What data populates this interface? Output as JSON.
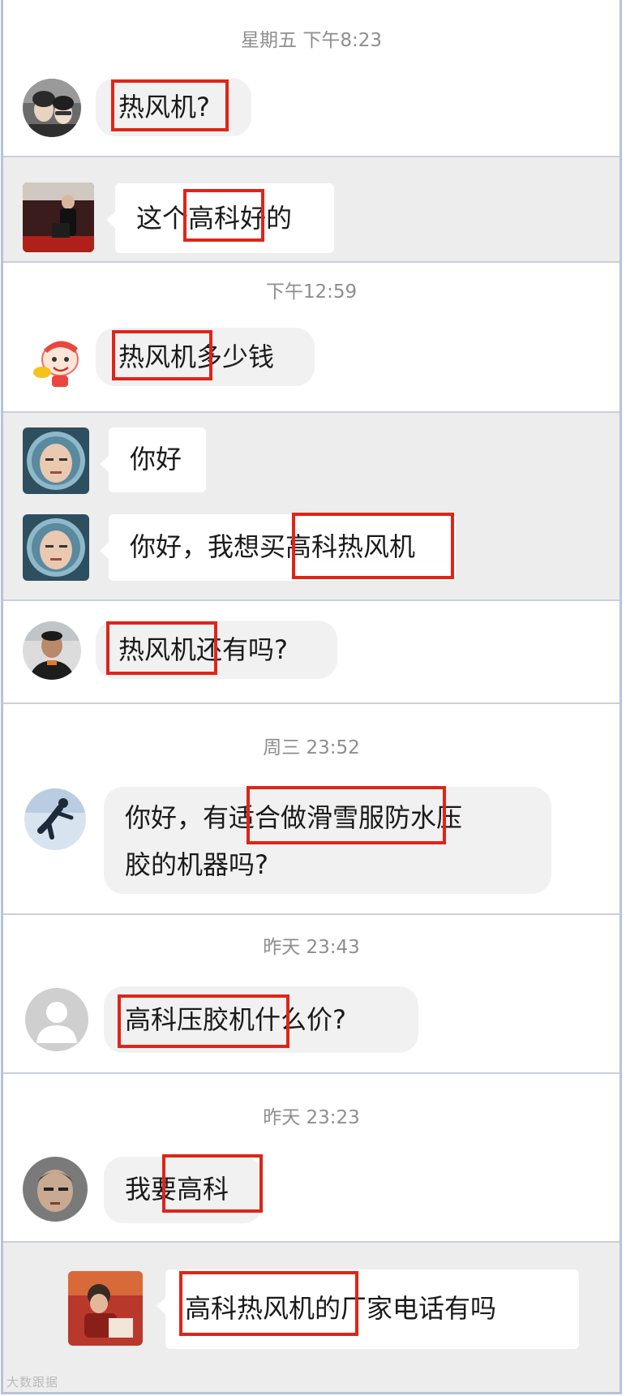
{
  "conversations": [
    {
      "id": "c1",
      "timestamp": "星期五 下午8:23",
      "messages": [
        {
          "text": "热风机?",
          "avatar": "couple-photo-avatar"
        }
      ]
    },
    {
      "id": "c2",
      "timestamp": "",
      "messages": [
        {
          "text": "这个高科好的",
          "avatar": "presenter-stage-avatar"
        }
      ]
    },
    {
      "id": "c3",
      "timestamp": "下午12:59",
      "messages": [
        {
          "text": "热风机多少钱",
          "avatar": "cartoon-boy-avatar"
        }
      ]
    },
    {
      "id": "c4",
      "timestamp": "",
      "messages": [
        {
          "text": "你好",
          "avatar": "water-frame-avatar"
        },
        {
          "text": "你好，我想买高科热风机",
          "avatar": "water-frame-avatar"
        }
      ]
    },
    {
      "id": "c5",
      "timestamp": "",
      "messages": [
        {
          "text": "热风机还有吗?",
          "avatar": "man-portrait-avatar"
        }
      ]
    },
    {
      "id": "c6",
      "timestamp": "周三 23:52",
      "messages": [
        {
          "text": "你好，有适合做滑雪服防水压胶的机器吗?",
          "line1": "你好，有适合做滑雪服防水压",
          "line2": "胶的机器吗?",
          "avatar": "skater-avatar"
        }
      ]
    },
    {
      "id": "c7",
      "timestamp": "昨天 23:43",
      "messages": [
        {
          "text": "高科压胶机什么价?",
          "avatar": "default-user-avatar"
        }
      ]
    },
    {
      "id": "c8",
      "timestamp": "昨天 23:23",
      "messages": [
        {
          "text": "我要高科",
          "avatar": "man-face-avatar"
        }
      ]
    },
    {
      "id": "c9",
      "timestamp": "",
      "messages": [
        {
          "text": "高科热风机的厂家电话有吗",
          "avatar": "child-red-avatar"
        }
      ]
    }
  ],
  "watermark": "大数跟据",
  "colors": {
    "highlight": "#e02418",
    "frame": "#b7c3da",
    "timestamp": "#8e8e8e",
    "grey_panel": "#ededed"
  }
}
